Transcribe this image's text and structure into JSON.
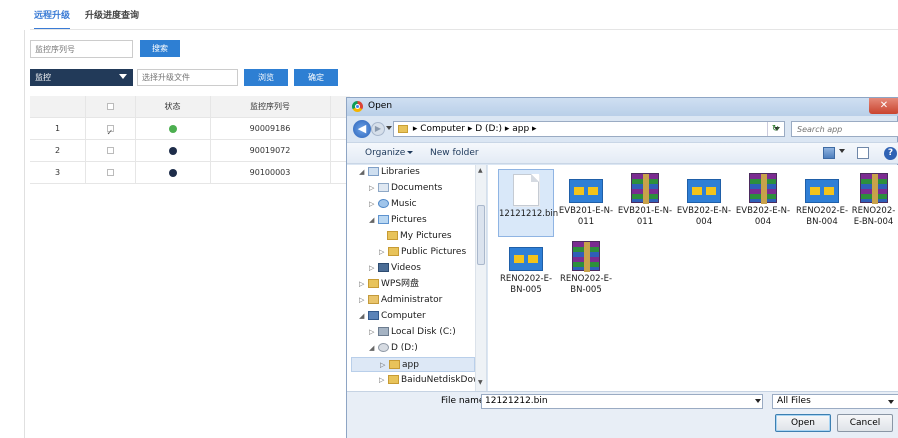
{
  "tabs": {
    "remote_upgrade": "远程升级",
    "progress_query": "升级进度查询"
  },
  "search": {
    "placeholder": "监控序列号",
    "button": "搜索"
  },
  "upgrade": {
    "select_value": "监控",
    "file_placeholder": "选择升级文件",
    "browse": "浏览",
    "confirm": "确定"
  },
  "table": {
    "headers": [
      "",
      "",
      "状态",
      "监控序列号"
    ],
    "rows": [
      {
        "index": "1",
        "checked": true,
        "status_color": "#4caf50",
        "serial": "90009186"
      },
      {
        "index": "2",
        "checked": false,
        "status_color": "#1e2d4a",
        "serial": "90019072"
      },
      {
        "index": "3",
        "checked": false,
        "status_color": "#1e2d4a",
        "serial": "90100003"
      }
    ]
  },
  "dialog": {
    "title": "Open",
    "address": "▸ Computer ▸ D (D:) ▸ app ▸",
    "search_placeholder": "Search app",
    "toolbar": {
      "organize": "Organize",
      "new_folder": "New folder"
    },
    "tree": [
      {
        "label": "Libraries",
        "icon": "lib",
        "indent": 0,
        "expanded": true
      },
      {
        "label": "Documents",
        "icon": "doc",
        "indent": 1
      },
      {
        "label": "Music",
        "icon": "music",
        "indent": 1
      },
      {
        "label": "Pictures",
        "icon": "pic",
        "indent": 1,
        "expanded": true
      },
      {
        "label": "My Pictures",
        "icon": "folder",
        "indent": 2
      },
      {
        "label": "Public Pictures",
        "icon": "folder",
        "indent": 2
      },
      {
        "label": "Videos",
        "icon": "vid",
        "indent": 1
      },
      {
        "label": "WPS网盘",
        "icon": "wps",
        "indent": 0
      },
      {
        "label": "Administrator",
        "icon": "admin",
        "indent": 0
      },
      {
        "label": "Computer",
        "icon": "comp",
        "indent": 0,
        "expanded": true
      },
      {
        "label": "Local Disk (C:)",
        "icon": "disk",
        "indent": 1
      },
      {
        "label": "D (D:)",
        "icon": "dvd",
        "indent": 1,
        "expanded": true
      },
      {
        "label": "app",
        "icon": "folder",
        "indent": 2,
        "selected": true
      },
      {
        "label": "BaiduNetdiskDown",
        "icon": "folder",
        "indent": 2
      }
    ],
    "files": [
      {
        "name": "12121212.bin",
        "kind": "doc",
        "selected": true
      },
      {
        "name": "EVB201-E-N-011",
        "kind": "link"
      },
      {
        "name": "EVB201-E-N-011",
        "kind": "rar"
      },
      {
        "name": "EVB202-E-N-004",
        "kind": "link"
      },
      {
        "name": "EVB202-E-N-004",
        "kind": "rar"
      },
      {
        "name": "RENO202-E-BN-004",
        "kind": "link"
      },
      {
        "name": "RENO202-E-BN-004",
        "kind": "rar"
      },
      {
        "name": "RENO202-E-BN-005",
        "kind": "link"
      },
      {
        "name": "RENO202-E-BN-005",
        "kind": "rar"
      }
    ],
    "filename_label": "File name:",
    "filename_value": "12121212.bin",
    "filter_value": "All Files",
    "open_button": "Open",
    "cancel_button": "Cancel"
  }
}
